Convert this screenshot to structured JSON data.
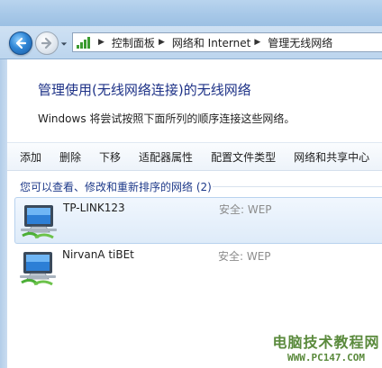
{
  "address": {
    "crumbs": [
      "控制面板",
      "网络和 Internet",
      "管理无线网络"
    ],
    "separator": "▶"
  },
  "main": {
    "heading": "管理使用(无线网络连接)的无线网络",
    "description": "Windows 将尝试按照下面所列的顺序连接这些网络。"
  },
  "toolbar": {
    "add": "添加",
    "remove": "删除",
    "move_down": "下移",
    "adapter_properties": "适配器属性",
    "profile_types": "配置文件类型",
    "sharing_center": "网络和共享中心"
  },
  "networks": {
    "group_title": "您可以查看、修改和重新排序的网络 (2)",
    "items": [
      {
        "name": "TP-LINK123",
        "security": "安全: WEP"
      },
      {
        "name": "NirvanA tiBEt",
        "security": "安全: WEP"
      }
    ]
  },
  "watermark": {
    "line1": "电脑技术教程网",
    "line2": "WWW.PC147.COM"
  },
  "colors": {
    "heading": "#1e3287",
    "group_title": "#1e3a8a",
    "security_text": "#8c8c8c"
  }
}
